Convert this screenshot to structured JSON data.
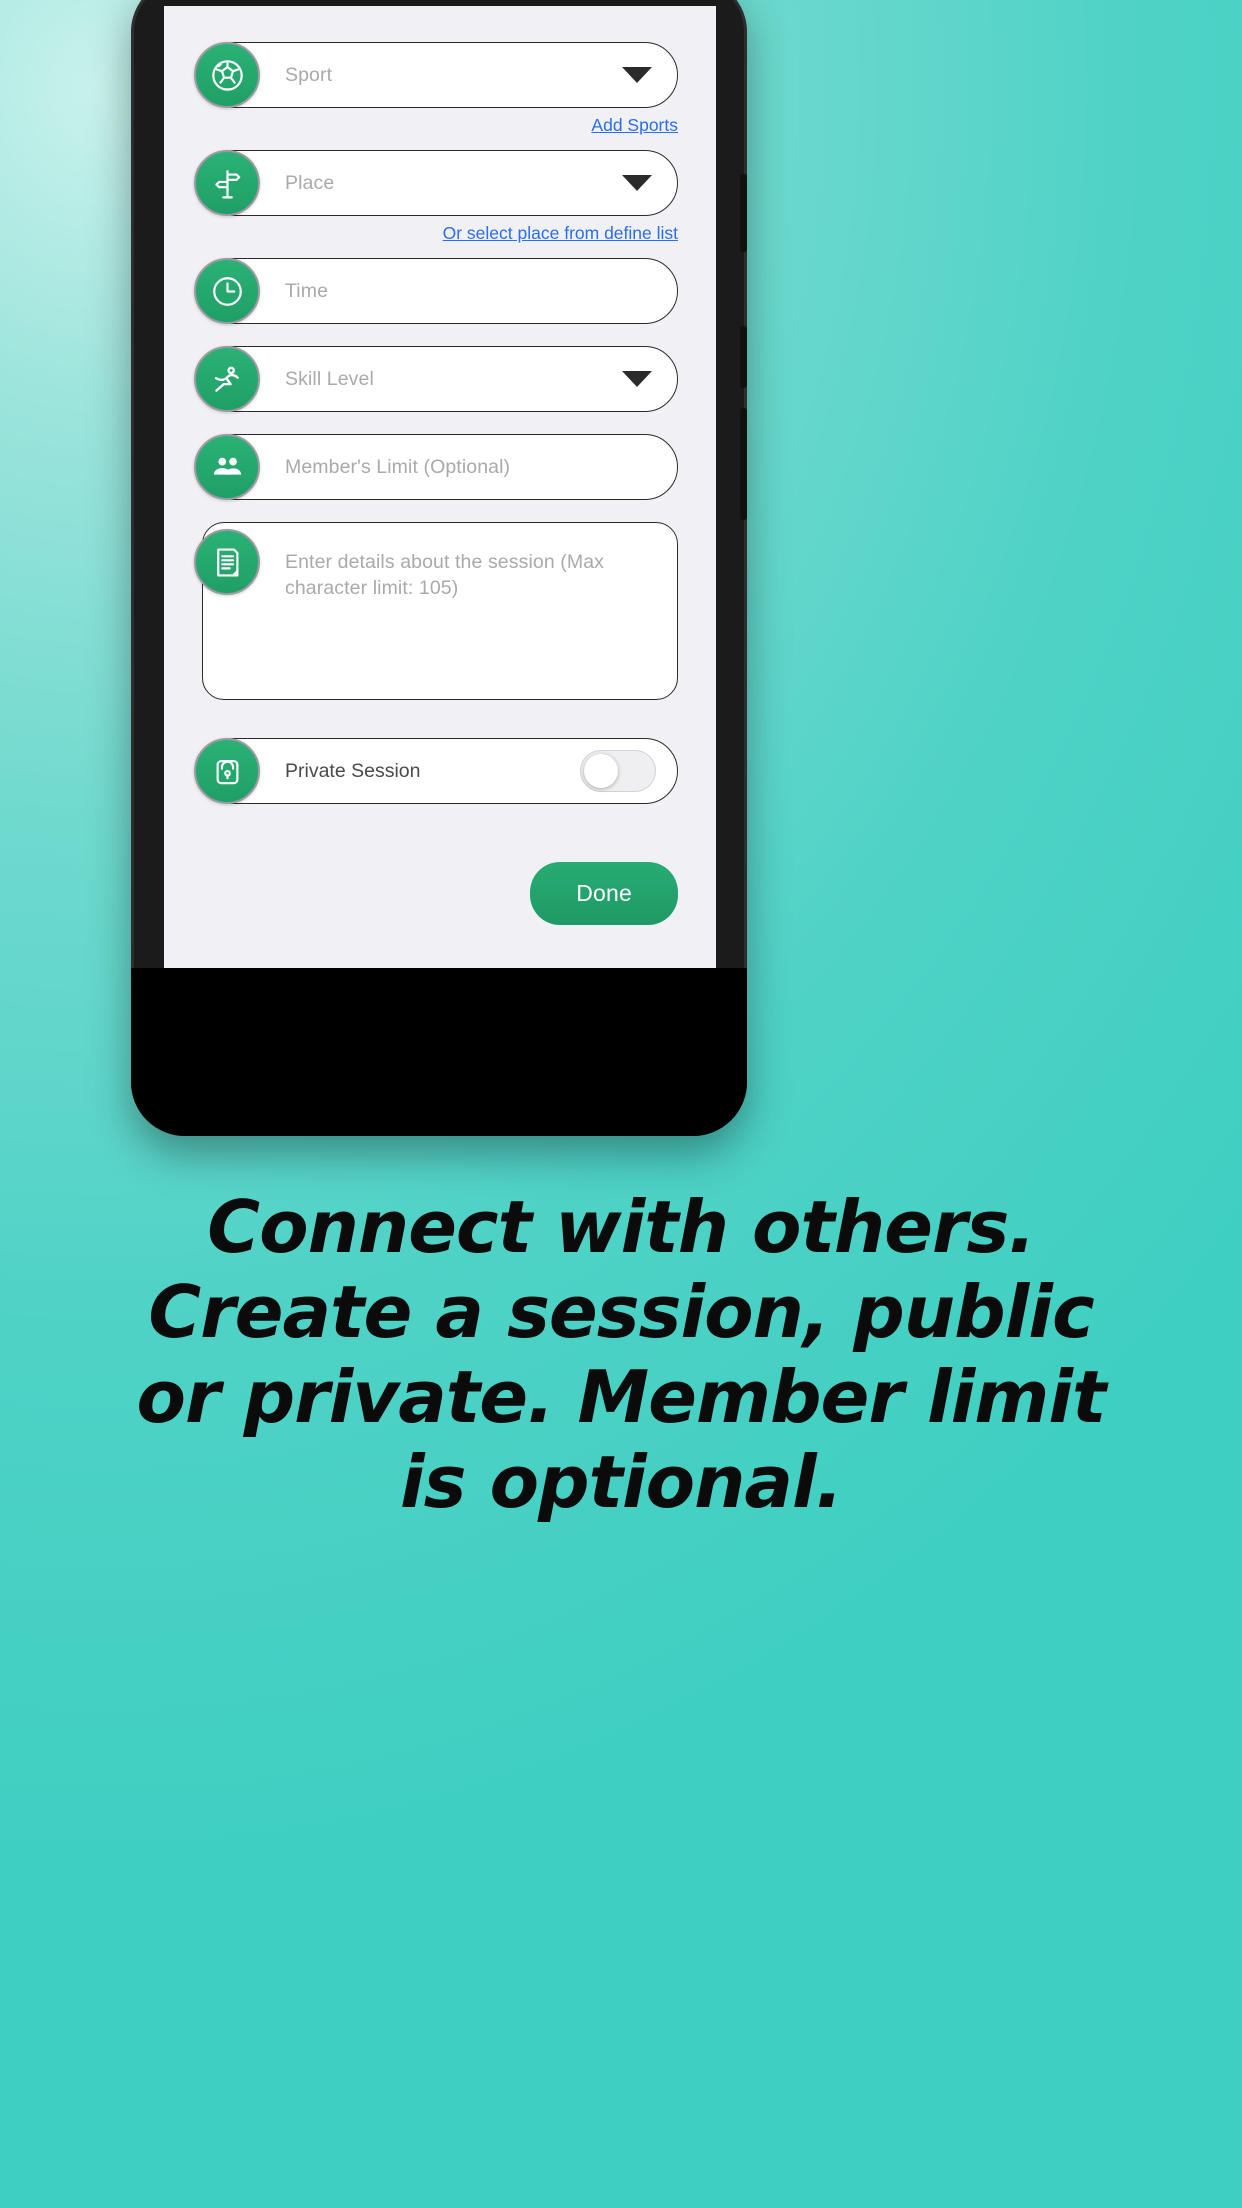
{
  "theme": {
    "accent_green": "#21a567",
    "link_blue": "#2a6ef0",
    "screen_bg": "#f0f0f5",
    "background_teal": "#4fd2c6",
    "placeholder_gray": "#a9a9ae"
  },
  "form": {
    "fields": [
      {
        "name": "sport",
        "icon": "soccer-ball-icon",
        "placeholder": "Sport",
        "value": "",
        "has_caret": true
      },
      {
        "name": "place",
        "icon": "signpost-icon",
        "placeholder": "Place",
        "value": "",
        "has_caret": true
      },
      {
        "name": "time",
        "icon": "clock-icon",
        "placeholder": "Time",
        "value": "",
        "has_caret": false
      },
      {
        "name": "skill",
        "icon": "runner-icon",
        "placeholder": "Skill Level",
        "value": "",
        "has_caret": true
      },
      {
        "name": "members",
        "icon": "people-icon",
        "placeholder": "Member's Limit (Optional)",
        "value": "",
        "has_caret": false
      }
    ],
    "links": {
      "add_sports": "Add Sports",
      "select_place": "Or select place from define list"
    },
    "details": {
      "icon": "document-icon",
      "placeholder": "Enter details about the session (Max character limit: 105)",
      "value": ""
    },
    "private_session": {
      "icon": "lock-icon",
      "label": "Private Session",
      "enabled": false
    },
    "done_label": "Done"
  },
  "caption": {
    "line1": "Connect with others.",
    "line2": "Create a session, public",
    "line3": "or private. Member limit",
    "line4": "is optional."
  }
}
